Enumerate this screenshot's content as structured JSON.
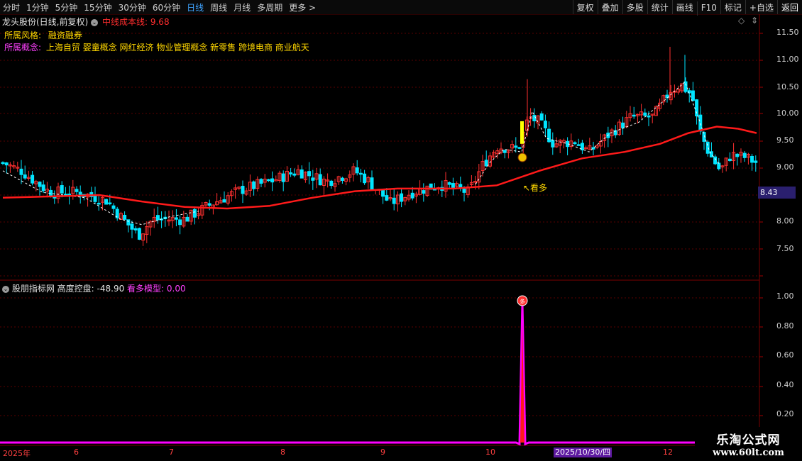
{
  "toolbar": {
    "periods": [
      "分时",
      "1分钟",
      "5分钟",
      "15分钟",
      "30分钟",
      "60分钟",
      "日线",
      "周线",
      "月线",
      "多周期",
      "更多 >"
    ],
    "active_period": "日线",
    "buttons": [
      "复权",
      "叠加",
      "多股",
      "统计",
      "画线",
      "F10",
      "标记",
      "+自选",
      "返回"
    ]
  },
  "header": {
    "stock_title": "龙头股份(日线,前复权)",
    "midline_label": "中线成本线: 9.68",
    "style_label": "所属风格:",
    "style_value": "融资融券",
    "concept_label": "所属概念:",
    "concept_value": "上海自贸 婴童概念 网红经济 物业管理概念 新零售 跨境电商 商业航天"
  },
  "main_chart": {
    "y_ticks": [
      "11.50",
      "11.00",
      "10.50",
      "10.00",
      "9.50",
      "9.00",
      "8.00",
      "7.50"
    ],
    "current_price": "8.43",
    "signal_label": "↖看多",
    "colors": {
      "up": "#ff3030",
      "down": "#00e5ff",
      "midline": "#ff1a1a",
      "signal_bar": "#ffff00"
    }
  },
  "indicator": {
    "name": "股朋指标网",
    "height_label": "高度控盘: -48.90",
    "model_label": "看多模型: 0.00",
    "y_ticks": [
      "1.00",
      "0.80",
      "0.60",
      "0.40",
      "0.20"
    ],
    "marker_text": "多"
  },
  "x_axis": {
    "labels": [
      "2025年",
      "6",
      "7",
      "8",
      "9",
      "10",
      "12"
    ],
    "cursor_date": "2025/10/30/四"
  },
  "watermark": {
    "line1": "乐淘公式网",
    "line2": "www.60lt.com"
  }
}
